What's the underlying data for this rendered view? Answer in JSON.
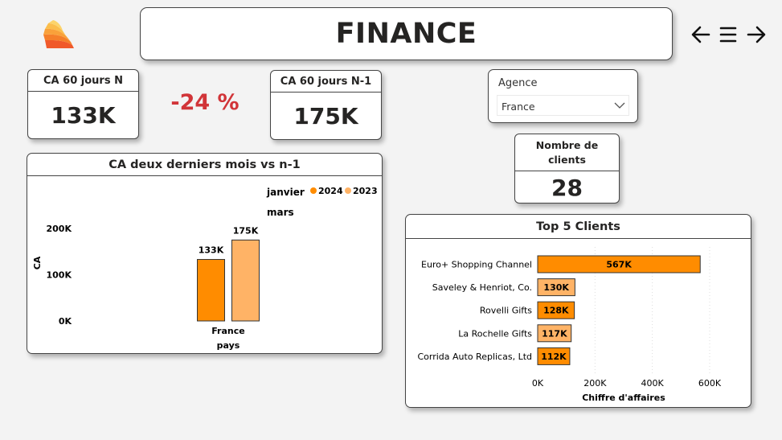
{
  "header": {
    "title": "FINANCE"
  },
  "nav": {
    "back_icon": "arrow-left-icon",
    "menu_icon": "menu-icon",
    "forward_icon": "arrow-right-icon",
    "logo_icon": "flame-logo-icon"
  },
  "kpis": {
    "ca_n": {
      "label": "CA 60 jours N",
      "value": "133K"
    },
    "delta": "-24 %",
    "ca_n1": {
      "label": "CA 60 jours N-1",
      "value": "175K"
    },
    "clients": {
      "label_line1": "Nombre de",
      "label_line2": "clients",
      "value": "28"
    }
  },
  "slicer": {
    "label": "Agence",
    "selected": "France"
  },
  "colors": {
    "orange": "#ff8c00",
    "light_orange": "#ffb366",
    "delta_red": "#d13438"
  },
  "chart_data": [
    {
      "type": "bar",
      "title": "CA deux derniers mois vs n-1",
      "legend_title": "janvier mars",
      "legend_position": "top-right",
      "categories": [
        "France"
      ],
      "series": [
        {
          "name": "2024",
          "values": [
            133
          ],
          "labels": [
            "133K"
          ]
        },
        {
          "name": "2023",
          "values": [
            175
          ],
          "labels": [
            "175K"
          ]
        }
      ],
      "xlabel": "pays",
      "ylabel": "CA",
      "yticks": [
        "0K",
        "100K",
        "200K"
      ],
      "ylim": [
        0,
        200
      ]
    },
    {
      "type": "bar",
      "orientation": "horizontal",
      "title": "Top 5 Clients",
      "categories": [
        "Euro+ Shopping Channel",
        "Saveley & Henriot, Co.",
        "Rovelli Gifts",
        "La Rochelle Gifts",
        "Corrida Auto Replicas, Ltd"
      ],
      "values": [
        567,
        130,
        128,
        117,
        112
      ],
      "labels": [
        "567K",
        "130K",
        "128K",
        "117K",
        "112K"
      ],
      "xlabel": "Chiffre d'affaires",
      "xticks": [
        "0K",
        "200K",
        "400K",
        "600K"
      ],
      "xlim": [
        0,
        600
      ]
    }
  ]
}
